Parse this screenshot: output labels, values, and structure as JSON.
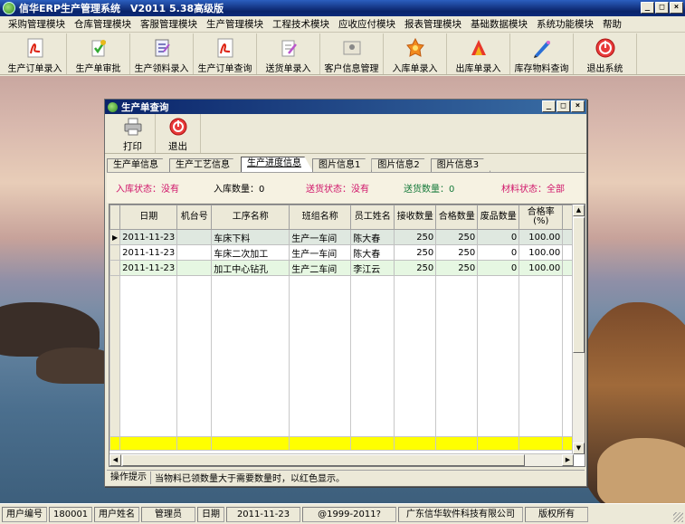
{
  "app": {
    "title": "信华ERP生产管理系统　V2011 5.38高级版",
    "colors": {
      "title_bg": "#0a246a",
      "pink_status": "#d0156a",
      "green_status": "#157a3a",
      "sum_row": "#ffff00"
    }
  },
  "menu": [
    "采购管理模块",
    "仓库管理模块",
    "客服管理模块",
    "生产管理模块",
    "工程技术模块",
    "应收应付模块",
    "报表管理模块",
    "基础数据模块",
    "系统功能模块",
    "帮助"
  ],
  "toolbar": [
    {
      "label": "生产订单录入",
      "icon": "pdf-icon"
    },
    {
      "label": "生产单审批",
      "icon": "approve-icon"
    },
    {
      "label": "生产领料录入",
      "icon": "requisition-icon"
    },
    {
      "label": "生产订单查询",
      "icon": "pdf-icon"
    },
    {
      "label": "送货单录入",
      "icon": "delivery-icon"
    },
    {
      "label": "客户信息管理",
      "icon": "customer-icon"
    },
    {
      "label": "入库单录入",
      "icon": "stock-in-icon"
    },
    {
      "label": "出库单录入",
      "icon": "stock-out-icon"
    },
    {
      "label": "库存物料查询",
      "icon": "inventory-icon"
    },
    {
      "label": "退出系统",
      "icon": "exit-icon"
    }
  ],
  "child": {
    "title": "生产单查询",
    "tools": [
      {
        "label": "打印",
        "icon": "printer-icon"
      },
      {
        "label": "退出",
        "icon": "exit-icon"
      }
    ],
    "tabs": [
      "生产单信息",
      "生产工艺信息",
      "生产进度信息",
      "图片信息1",
      "图片信息2",
      "图片信息3"
    ],
    "active_tab": 2,
    "status": {
      "in_status": "入库状态：没有",
      "in_qty": "入库数量：0",
      "deliver_status": "送货状态：没有",
      "deliver_qty": "送货数量：0",
      "material_status": "材料状态：全部"
    },
    "grid": {
      "columns": [
        "日期",
        "机台号",
        "工序名称",
        "班组名称",
        "员工姓名",
        "接收数量",
        "合格数量",
        "废品数量",
        "合格率\n(%)"
      ],
      "rows": [
        [
          "2011-11-23",
          "",
          "车床下料",
          "生产一车间",
          "陈大春",
          "250",
          "250",
          "0",
          "100.00"
        ],
        [
          "2011-11-23",
          "",
          "车床二次加工",
          "生产一车间",
          "陈大春",
          "250",
          "250",
          "0",
          "100.00"
        ],
        [
          "2011-11-23",
          "",
          "加工中心钻孔",
          "生产二车间",
          "李江云",
          "250",
          "250",
          "0",
          "100.00"
        ]
      ]
    },
    "hint": {
      "label": "操作提示",
      "text": "当物料已领数量大于需要数量时，以红色显示。"
    }
  },
  "statusbar": {
    "user_no_label": "用户编号",
    "user_no": "180001",
    "user_name_label": "用户姓名",
    "user_name": "管理员",
    "date_label": "日期",
    "date": "2011-11-23",
    "copyright": "@1999-2011?",
    "company": "广东信华软件科技有限公司",
    "rights": "版权所有"
  }
}
